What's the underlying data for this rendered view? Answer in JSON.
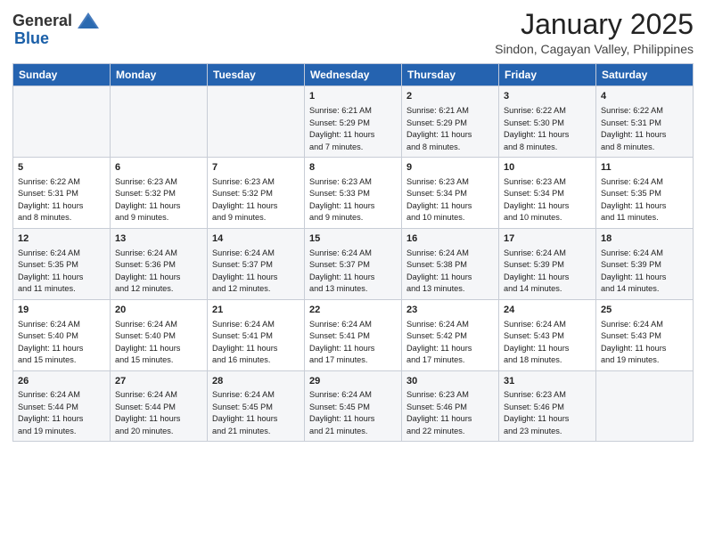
{
  "header": {
    "logo_general": "General",
    "logo_blue": "Blue",
    "month_year": "January 2025",
    "location": "Sindon, Cagayan Valley, Philippines"
  },
  "days_of_week": [
    "Sunday",
    "Monday",
    "Tuesday",
    "Wednesday",
    "Thursday",
    "Friday",
    "Saturday"
  ],
  "weeks": [
    [
      {
        "day": "",
        "info": ""
      },
      {
        "day": "",
        "info": ""
      },
      {
        "day": "",
        "info": ""
      },
      {
        "day": "1",
        "info": "Sunrise: 6:21 AM\nSunset: 5:29 PM\nDaylight: 11 hours\nand 7 minutes."
      },
      {
        "day": "2",
        "info": "Sunrise: 6:21 AM\nSunset: 5:29 PM\nDaylight: 11 hours\nand 8 minutes."
      },
      {
        "day": "3",
        "info": "Sunrise: 6:22 AM\nSunset: 5:30 PM\nDaylight: 11 hours\nand 8 minutes."
      },
      {
        "day": "4",
        "info": "Sunrise: 6:22 AM\nSunset: 5:31 PM\nDaylight: 11 hours\nand 8 minutes."
      }
    ],
    [
      {
        "day": "5",
        "info": "Sunrise: 6:22 AM\nSunset: 5:31 PM\nDaylight: 11 hours\nand 8 minutes."
      },
      {
        "day": "6",
        "info": "Sunrise: 6:23 AM\nSunset: 5:32 PM\nDaylight: 11 hours\nand 9 minutes."
      },
      {
        "day": "7",
        "info": "Sunrise: 6:23 AM\nSunset: 5:32 PM\nDaylight: 11 hours\nand 9 minutes."
      },
      {
        "day": "8",
        "info": "Sunrise: 6:23 AM\nSunset: 5:33 PM\nDaylight: 11 hours\nand 9 minutes."
      },
      {
        "day": "9",
        "info": "Sunrise: 6:23 AM\nSunset: 5:34 PM\nDaylight: 11 hours\nand 10 minutes."
      },
      {
        "day": "10",
        "info": "Sunrise: 6:23 AM\nSunset: 5:34 PM\nDaylight: 11 hours\nand 10 minutes."
      },
      {
        "day": "11",
        "info": "Sunrise: 6:24 AM\nSunset: 5:35 PM\nDaylight: 11 hours\nand 11 minutes."
      }
    ],
    [
      {
        "day": "12",
        "info": "Sunrise: 6:24 AM\nSunset: 5:35 PM\nDaylight: 11 hours\nand 11 minutes."
      },
      {
        "day": "13",
        "info": "Sunrise: 6:24 AM\nSunset: 5:36 PM\nDaylight: 11 hours\nand 12 minutes."
      },
      {
        "day": "14",
        "info": "Sunrise: 6:24 AM\nSunset: 5:37 PM\nDaylight: 11 hours\nand 12 minutes."
      },
      {
        "day": "15",
        "info": "Sunrise: 6:24 AM\nSunset: 5:37 PM\nDaylight: 11 hours\nand 13 minutes."
      },
      {
        "day": "16",
        "info": "Sunrise: 6:24 AM\nSunset: 5:38 PM\nDaylight: 11 hours\nand 13 minutes."
      },
      {
        "day": "17",
        "info": "Sunrise: 6:24 AM\nSunset: 5:39 PM\nDaylight: 11 hours\nand 14 minutes."
      },
      {
        "day": "18",
        "info": "Sunrise: 6:24 AM\nSunset: 5:39 PM\nDaylight: 11 hours\nand 14 minutes."
      }
    ],
    [
      {
        "day": "19",
        "info": "Sunrise: 6:24 AM\nSunset: 5:40 PM\nDaylight: 11 hours\nand 15 minutes."
      },
      {
        "day": "20",
        "info": "Sunrise: 6:24 AM\nSunset: 5:40 PM\nDaylight: 11 hours\nand 15 minutes."
      },
      {
        "day": "21",
        "info": "Sunrise: 6:24 AM\nSunset: 5:41 PM\nDaylight: 11 hours\nand 16 minutes."
      },
      {
        "day": "22",
        "info": "Sunrise: 6:24 AM\nSunset: 5:41 PM\nDaylight: 11 hours\nand 17 minutes."
      },
      {
        "day": "23",
        "info": "Sunrise: 6:24 AM\nSunset: 5:42 PM\nDaylight: 11 hours\nand 17 minutes."
      },
      {
        "day": "24",
        "info": "Sunrise: 6:24 AM\nSunset: 5:43 PM\nDaylight: 11 hours\nand 18 minutes."
      },
      {
        "day": "25",
        "info": "Sunrise: 6:24 AM\nSunset: 5:43 PM\nDaylight: 11 hours\nand 19 minutes."
      }
    ],
    [
      {
        "day": "26",
        "info": "Sunrise: 6:24 AM\nSunset: 5:44 PM\nDaylight: 11 hours\nand 19 minutes."
      },
      {
        "day": "27",
        "info": "Sunrise: 6:24 AM\nSunset: 5:44 PM\nDaylight: 11 hours\nand 20 minutes."
      },
      {
        "day": "28",
        "info": "Sunrise: 6:24 AM\nSunset: 5:45 PM\nDaylight: 11 hours\nand 21 minutes."
      },
      {
        "day": "29",
        "info": "Sunrise: 6:24 AM\nSunset: 5:45 PM\nDaylight: 11 hours\nand 21 minutes."
      },
      {
        "day": "30",
        "info": "Sunrise: 6:23 AM\nSunset: 5:46 PM\nDaylight: 11 hours\nand 22 minutes."
      },
      {
        "day": "31",
        "info": "Sunrise: 6:23 AM\nSunset: 5:46 PM\nDaylight: 11 hours\nand 23 minutes."
      },
      {
        "day": "",
        "info": ""
      }
    ]
  ]
}
